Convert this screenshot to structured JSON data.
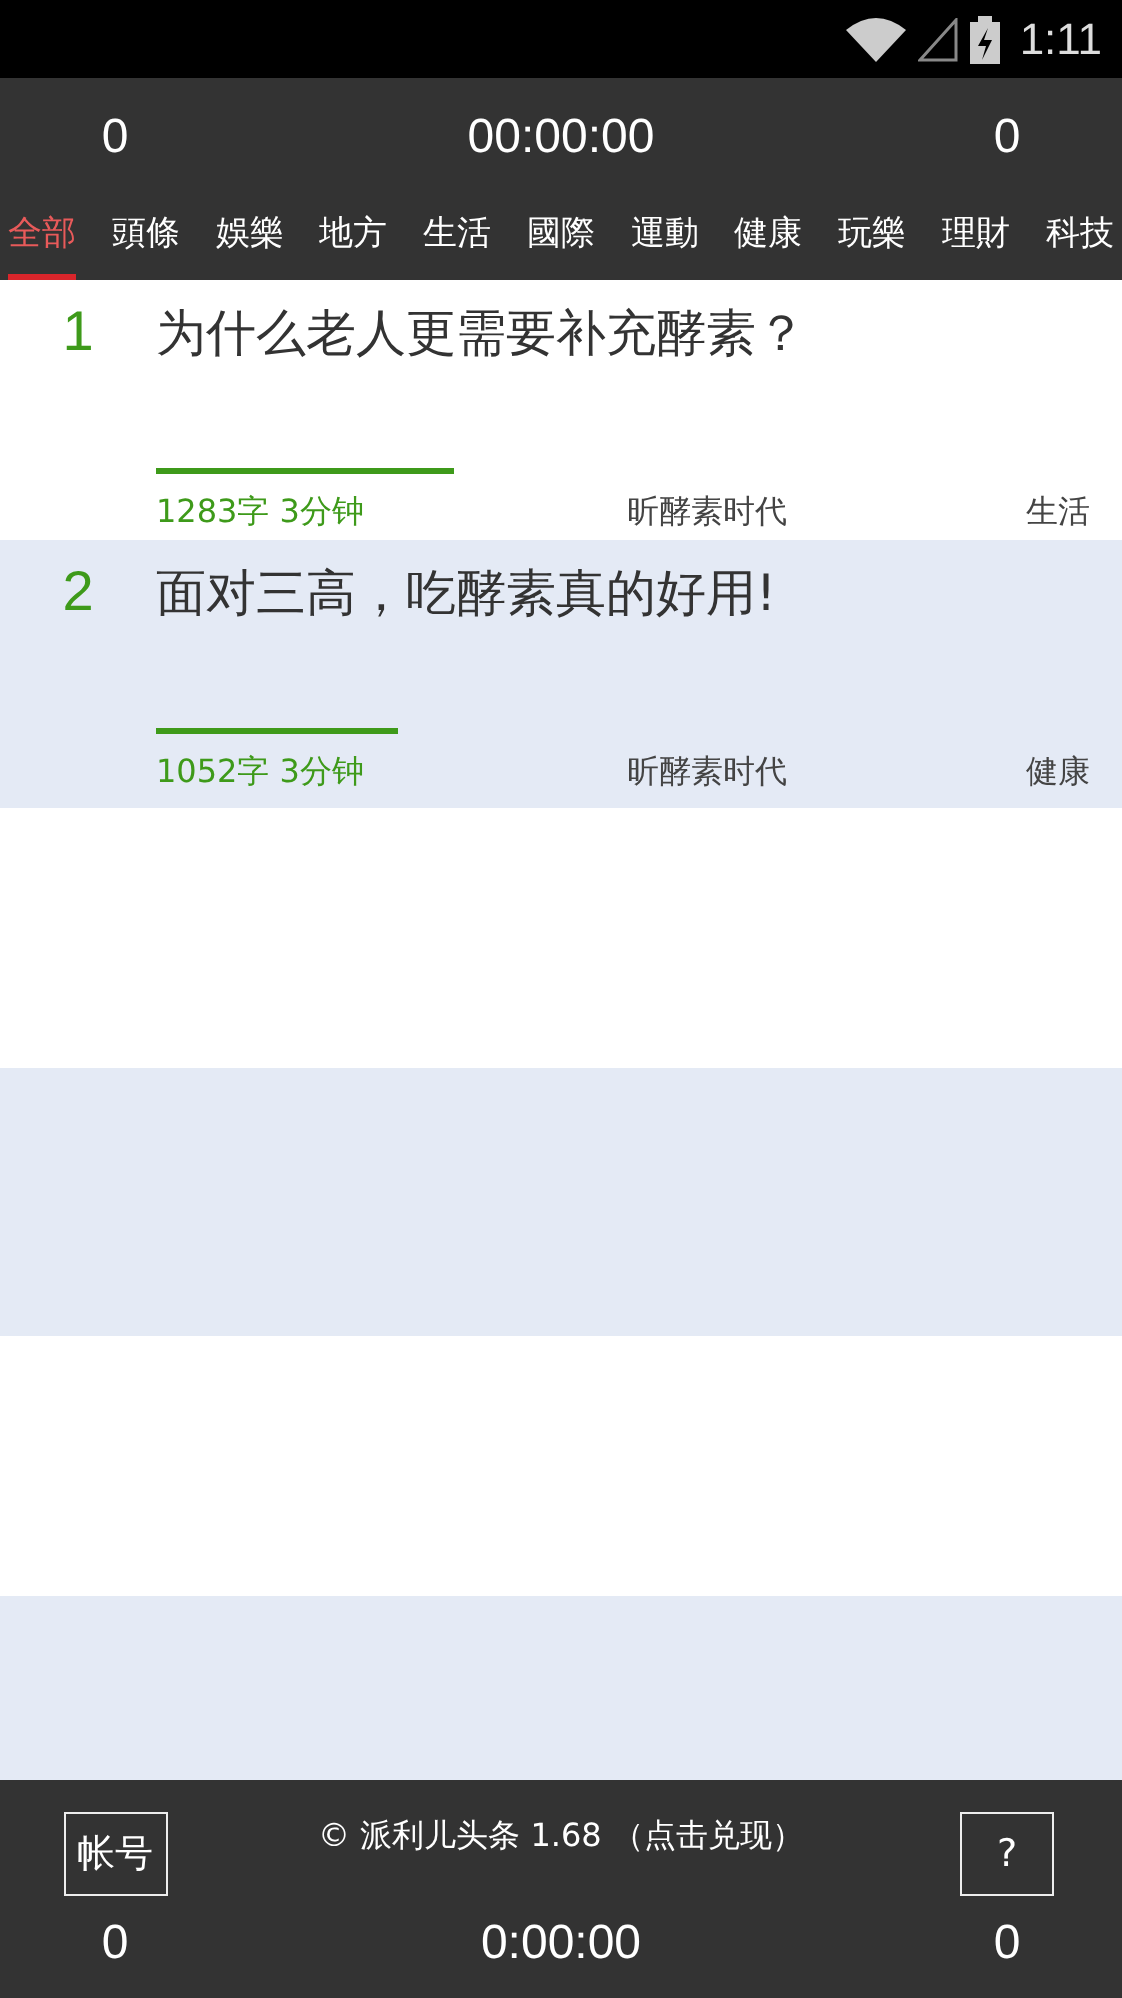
{
  "status_bar": {
    "time": "1:11"
  },
  "header": {
    "left_count": "0",
    "timer": "00:00:00",
    "right_count": "0"
  },
  "tabs": [
    {
      "label": "全部",
      "selected": true
    },
    {
      "label": "頭條",
      "selected": false
    },
    {
      "label": "娛樂",
      "selected": false
    },
    {
      "label": "地方",
      "selected": false
    },
    {
      "label": "生活",
      "selected": false
    },
    {
      "label": "國際",
      "selected": false
    },
    {
      "label": "運動",
      "selected": false
    },
    {
      "label": "健康",
      "selected": false
    },
    {
      "label": "玩樂",
      "selected": false
    },
    {
      "label": "理財",
      "selected": false
    },
    {
      "label": "科技",
      "selected": false
    }
  ],
  "articles": [
    {
      "rank": "1",
      "title": "为什么老人更需要补充酵素？",
      "level": 0.32,
      "stats": "1283字 3分钟",
      "source": "昕酵素时代",
      "category": "生活"
    },
    {
      "rank": "2",
      "title": "面对三高，吃酵素真的好用!",
      "level": 0.26,
      "stats": "1052字 3分钟",
      "source": "昕酵素时代",
      "category": "健康"
    }
  ],
  "footer": {
    "account_button": "帐号",
    "copyright": "© 派利儿头条 1.68 （点击兑现）",
    "help_button": "?",
    "left_count": "0",
    "timer": "0:00:00",
    "right_count": "0"
  }
}
